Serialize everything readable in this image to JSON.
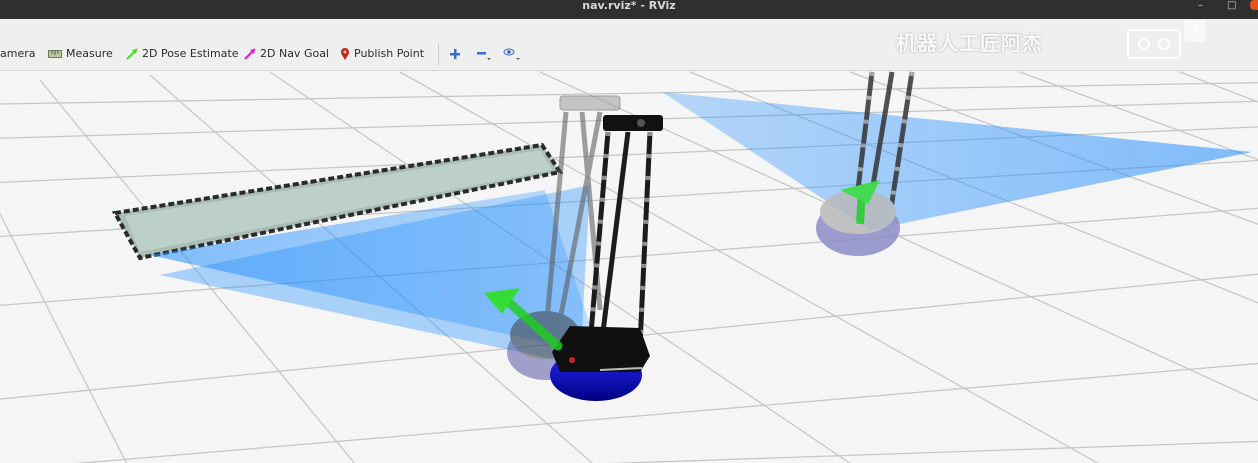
{
  "window": {
    "title": "nav.rviz* - RViz",
    "controls": [
      "–",
      "□"
    ]
  },
  "toolbar": {
    "items": [
      {
        "label": "amera",
        "icon": "camera-icon"
      },
      {
        "label": "Measure",
        "icon": "ruler-icon"
      },
      {
        "label": "2D Pose Estimate",
        "icon": "green-arrow-icon",
        "color": "#44dd22"
      },
      {
        "label": "2D Nav Goal",
        "icon": "magenta-arrow-icon",
        "color": "#d01fd0"
      },
      {
        "label": "Publish Point",
        "icon": "map-pin-icon",
        "color": "#c0281e"
      }
    ],
    "icon_buttons": [
      "plus-icon",
      "minus-icon",
      "eye-dropdown-icon"
    ]
  },
  "watermark": {
    "text": "机器人工匠阿杰",
    "logo": "cassette-tape-icon",
    "help": "?"
  },
  "scene": {
    "background": "#f4f4f4",
    "grid_color": "#bdbdbd",
    "laser_color": "#1e8cff",
    "pose_arrow_color": "#22cc22",
    "robot_base_color": "#1010a0",
    "robot_top_color": "#111111"
  }
}
